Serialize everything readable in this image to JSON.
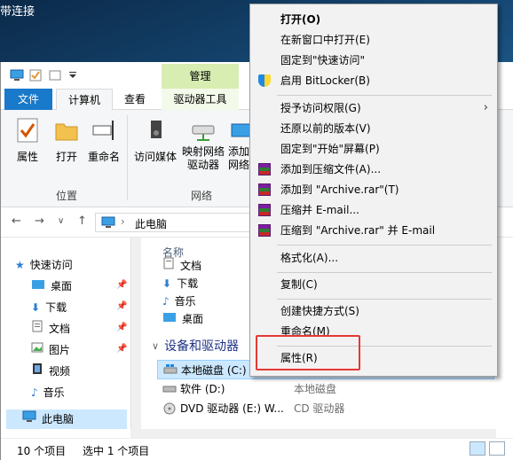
{
  "desktop": {
    "text": "带连接"
  },
  "titlebar": {
    "manage_tab": "管理"
  },
  "ribbon_tabs": {
    "file": "文件",
    "computer": "计算机",
    "view": "查看",
    "drive_tools": "驱动器工具"
  },
  "ribbon": {
    "properties": "属性",
    "open": "打开",
    "rename": "重命名",
    "access_media": "访问媒体",
    "map_drive_1": "映射网络",
    "map_drive_2": "驱动器",
    "add_1": "添加",
    "add_2": "网络",
    "group_location": "位置",
    "group_network": "网络"
  },
  "address": {
    "path": "此电脑"
  },
  "nav": {
    "quick_access": "快速访问",
    "desktop": "桌面",
    "downloads": "下载",
    "documents": "文档",
    "pictures": "图片",
    "videos": "视频",
    "music": "音乐",
    "this_pc": "此电脑"
  },
  "content": {
    "col_name": "名称",
    "folders": [
      "文档",
      "下载",
      "音乐",
      "桌面"
    ],
    "section_devices": "设备和驱动器",
    "drives": [
      {
        "name": "本地磁盘 (C:)",
        "type": ""
      },
      {
        "name": "软件 (D:)",
        "type": "本地磁盘"
      },
      {
        "name": "DVD 驱动器 (E:) W...",
        "type": "CD 驱动器"
      }
    ]
  },
  "status": {
    "count": "10 个项目",
    "selected": "选中 1 个项目"
  },
  "context_menu": {
    "items": [
      "打开(O)",
      "在新窗口中打开(E)",
      "固定到\"快速访问\"",
      "启用 BitLocker(B)",
      "授予访问权限(G)",
      "还原以前的版本(V)",
      "固定到\"开始\"屏幕(P)",
      "添加到压缩文件(A)...",
      "添加到 \"Archive.rar\"(T)",
      "压缩并 E-mail...",
      "压缩到 \"Archive.rar\" 并 E-mail",
      "格式化(A)...",
      "复制(C)",
      "创建快捷方式(S)",
      "重命名(M)",
      "属性(R)"
    ]
  },
  "colors": {
    "accent": "#1979ca",
    "manage_tab": "#d7edb2",
    "highlight": "#e53935",
    "selection": "#cce8ff"
  }
}
